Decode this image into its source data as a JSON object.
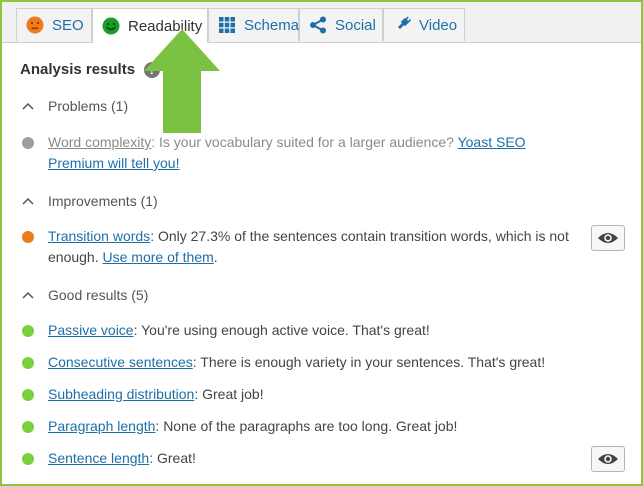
{
  "tabs": [
    {
      "label": "SEO",
      "icon": "sad-face-icon"
    },
    {
      "label": "Readability",
      "icon": "smile-face-icon"
    },
    {
      "label": "Schema",
      "icon": "grid-icon"
    },
    {
      "label": "Social",
      "icon": "share-icon"
    },
    {
      "label": "Video",
      "icon": "video-plug-icon"
    }
  ],
  "heading": "Analysis results",
  "help_glyph": "?",
  "colors": {
    "frame": "#8cc63f",
    "good": "#7ad03a",
    "ok": "#ee7c1b",
    "muted": "#9e9e9e",
    "link": "#1e6fa8",
    "arrow": "#7cc242"
  },
  "sections": {
    "problems": {
      "title": "Problems (1)",
      "items": [
        {
          "link": "Word complexity",
          "text": ": Is your vocabulary suited for a larger audience? ",
          "link2": "Yoast SEO Premium will tell you!",
          "tail": ""
        }
      ]
    },
    "improvements": {
      "title": "Improvements (1)",
      "items": [
        {
          "link": "Transition words",
          "text": ": Only 27.3% of the sentences contain transition words, which is not enough. ",
          "link2": "Use more of them",
          "tail": "."
        }
      ]
    },
    "good": {
      "title": "Good results (5)",
      "items": [
        {
          "link": "Passive voice",
          "text": ": You're using enough active voice. That's great!"
        },
        {
          "link": "Consecutive sentences",
          "text": ": There is enough variety in your sentences. That's great!"
        },
        {
          "link": "Subheading distribution",
          "text": ": Great job!"
        },
        {
          "link": "Paragraph length",
          "text": ": None of the paragraphs are too long. Great job!"
        },
        {
          "link": "Sentence length",
          "text": ": Great!"
        }
      ]
    }
  }
}
